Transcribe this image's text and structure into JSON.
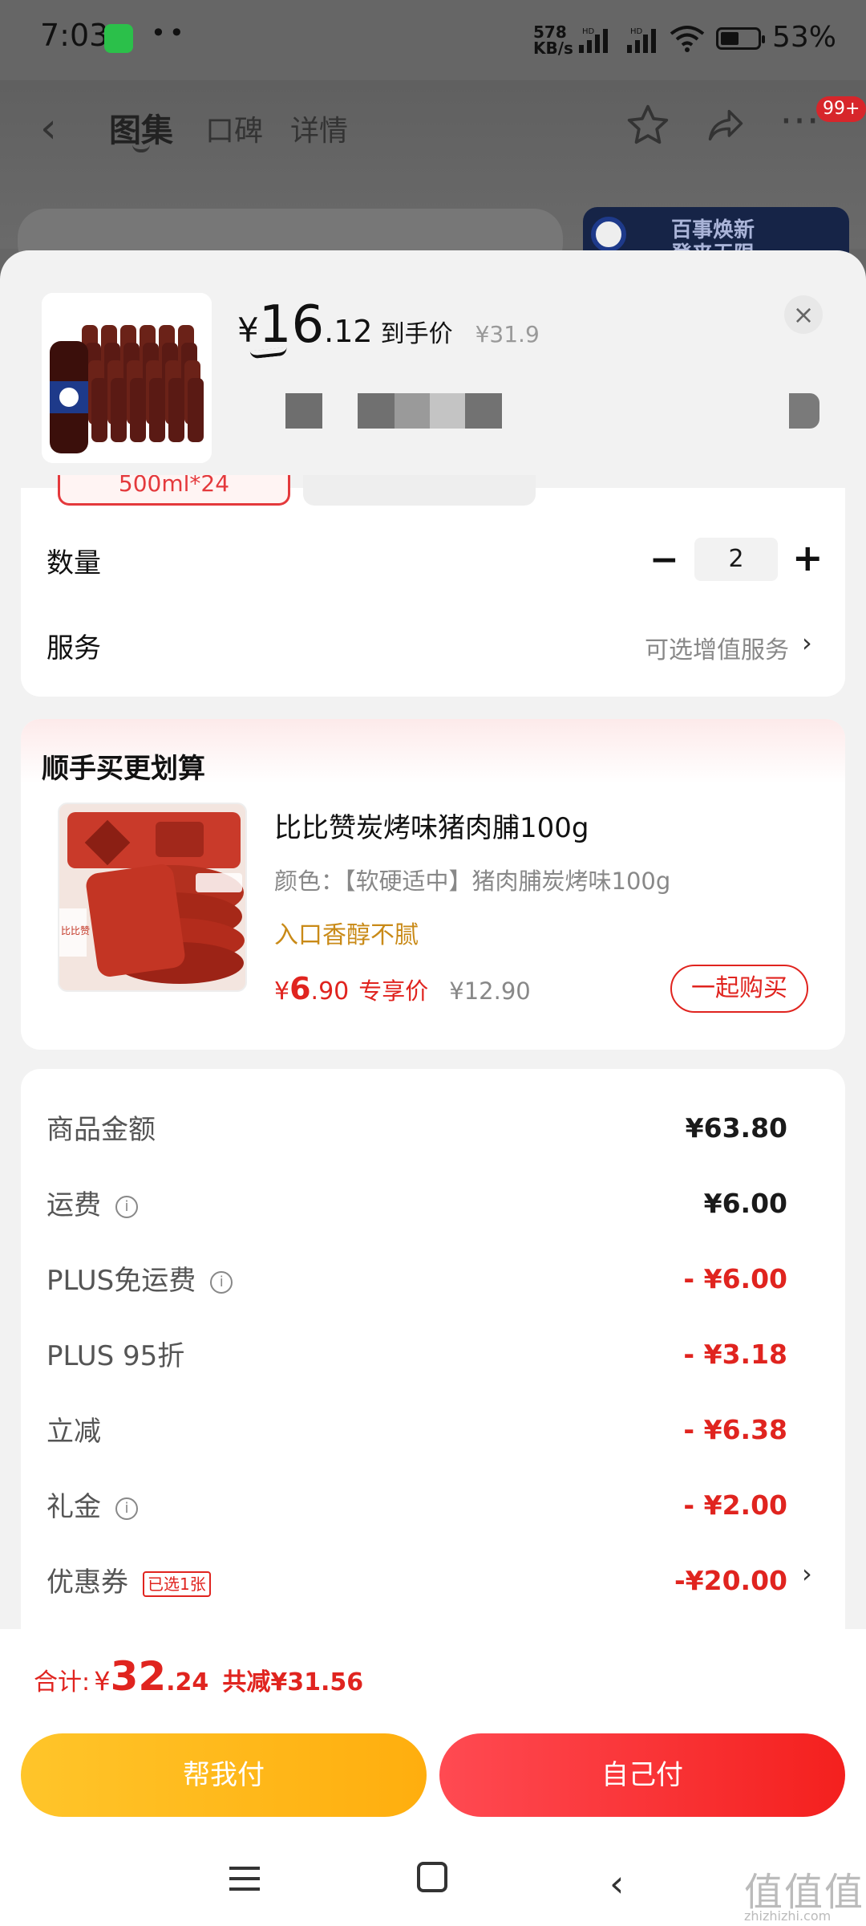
{
  "status_bar": {
    "time": "7:03",
    "net_speed_num": "578",
    "net_speed_unit": "KB/s",
    "signal_label": "HD",
    "battery": "53%"
  },
  "background_nav": {
    "tabs": [
      "图集",
      "口碑",
      "详情"
    ],
    "badge": "99+",
    "banner_text_1": "百事焕新",
    "banner_text_2": "登来无限",
    "banner_logo": "PEPSI"
  },
  "product": {
    "currency": "¥",
    "price_int": "16",
    "price_dec": ".12",
    "price_label": "到手价",
    "original_price": "¥31.9",
    "variant_chip": "500ml*24"
  },
  "quantity": {
    "label": "数量",
    "value": "2",
    "minus": "−",
    "plus": "+"
  },
  "service": {
    "label": "服务",
    "value": "可选增值服务",
    "chevron": "›"
  },
  "addon": {
    "title": "顺手买更划算",
    "name": "比比赞炭烤味猪肉脯100g",
    "color": "颜色：【软硬适中】猪肉脯炭烤味100g",
    "slogan": "入口香醇不腻",
    "currency": "¥",
    "price_int": "6",
    "price_dec": ".90",
    "price_label": "专享价",
    "original_price": "¥12.90",
    "buy_button": "一起购买",
    "pack_text": "比比赞"
  },
  "fees": [
    {
      "label": "商品金额",
      "value": "¥63.80",
      "info": false
    },
    {
      "label": "运费",
      "value": "¥6.00",
      "info": true
    },
    {
      "label": "PLUS免运费",
      "value": "- ¥6.00",
      "info": true
    },
    {
      "label": "PLUS 95折",
      "value": "- ¥3.18",
      "info": false
    },
    {
      "label": "立减",
      "value": "- ¥6.38",
      "info": false
    },
    {
      "label": "礼金",
      "value": "- ¥2.00",
      "info": true
    },
    {
      "label": "优惠券",
      "value": "-¥20.00",
      "tag": "已选1张"
    }
  ],
  "total": {
    "label": "合计:",
    "currency": "¥",
    "int": "32",
    "dec": ".24",
    "saved": "共减¥31.56"
  },
  "buttons": {
    "help_pay": "帮我付",
    "self_pay": "自己付"
  },
  "icons": {
    "info": "i",
    "close": "×"
  },
  "watermark": {
    "text": "值值值",
    "url": "zhizhizhi.com"
  },
  "colors": {
    "accent_red": "#e0241f",
    "yellow": "#ffb81c",
    "gold_text": "#c98a17"
  }
}
